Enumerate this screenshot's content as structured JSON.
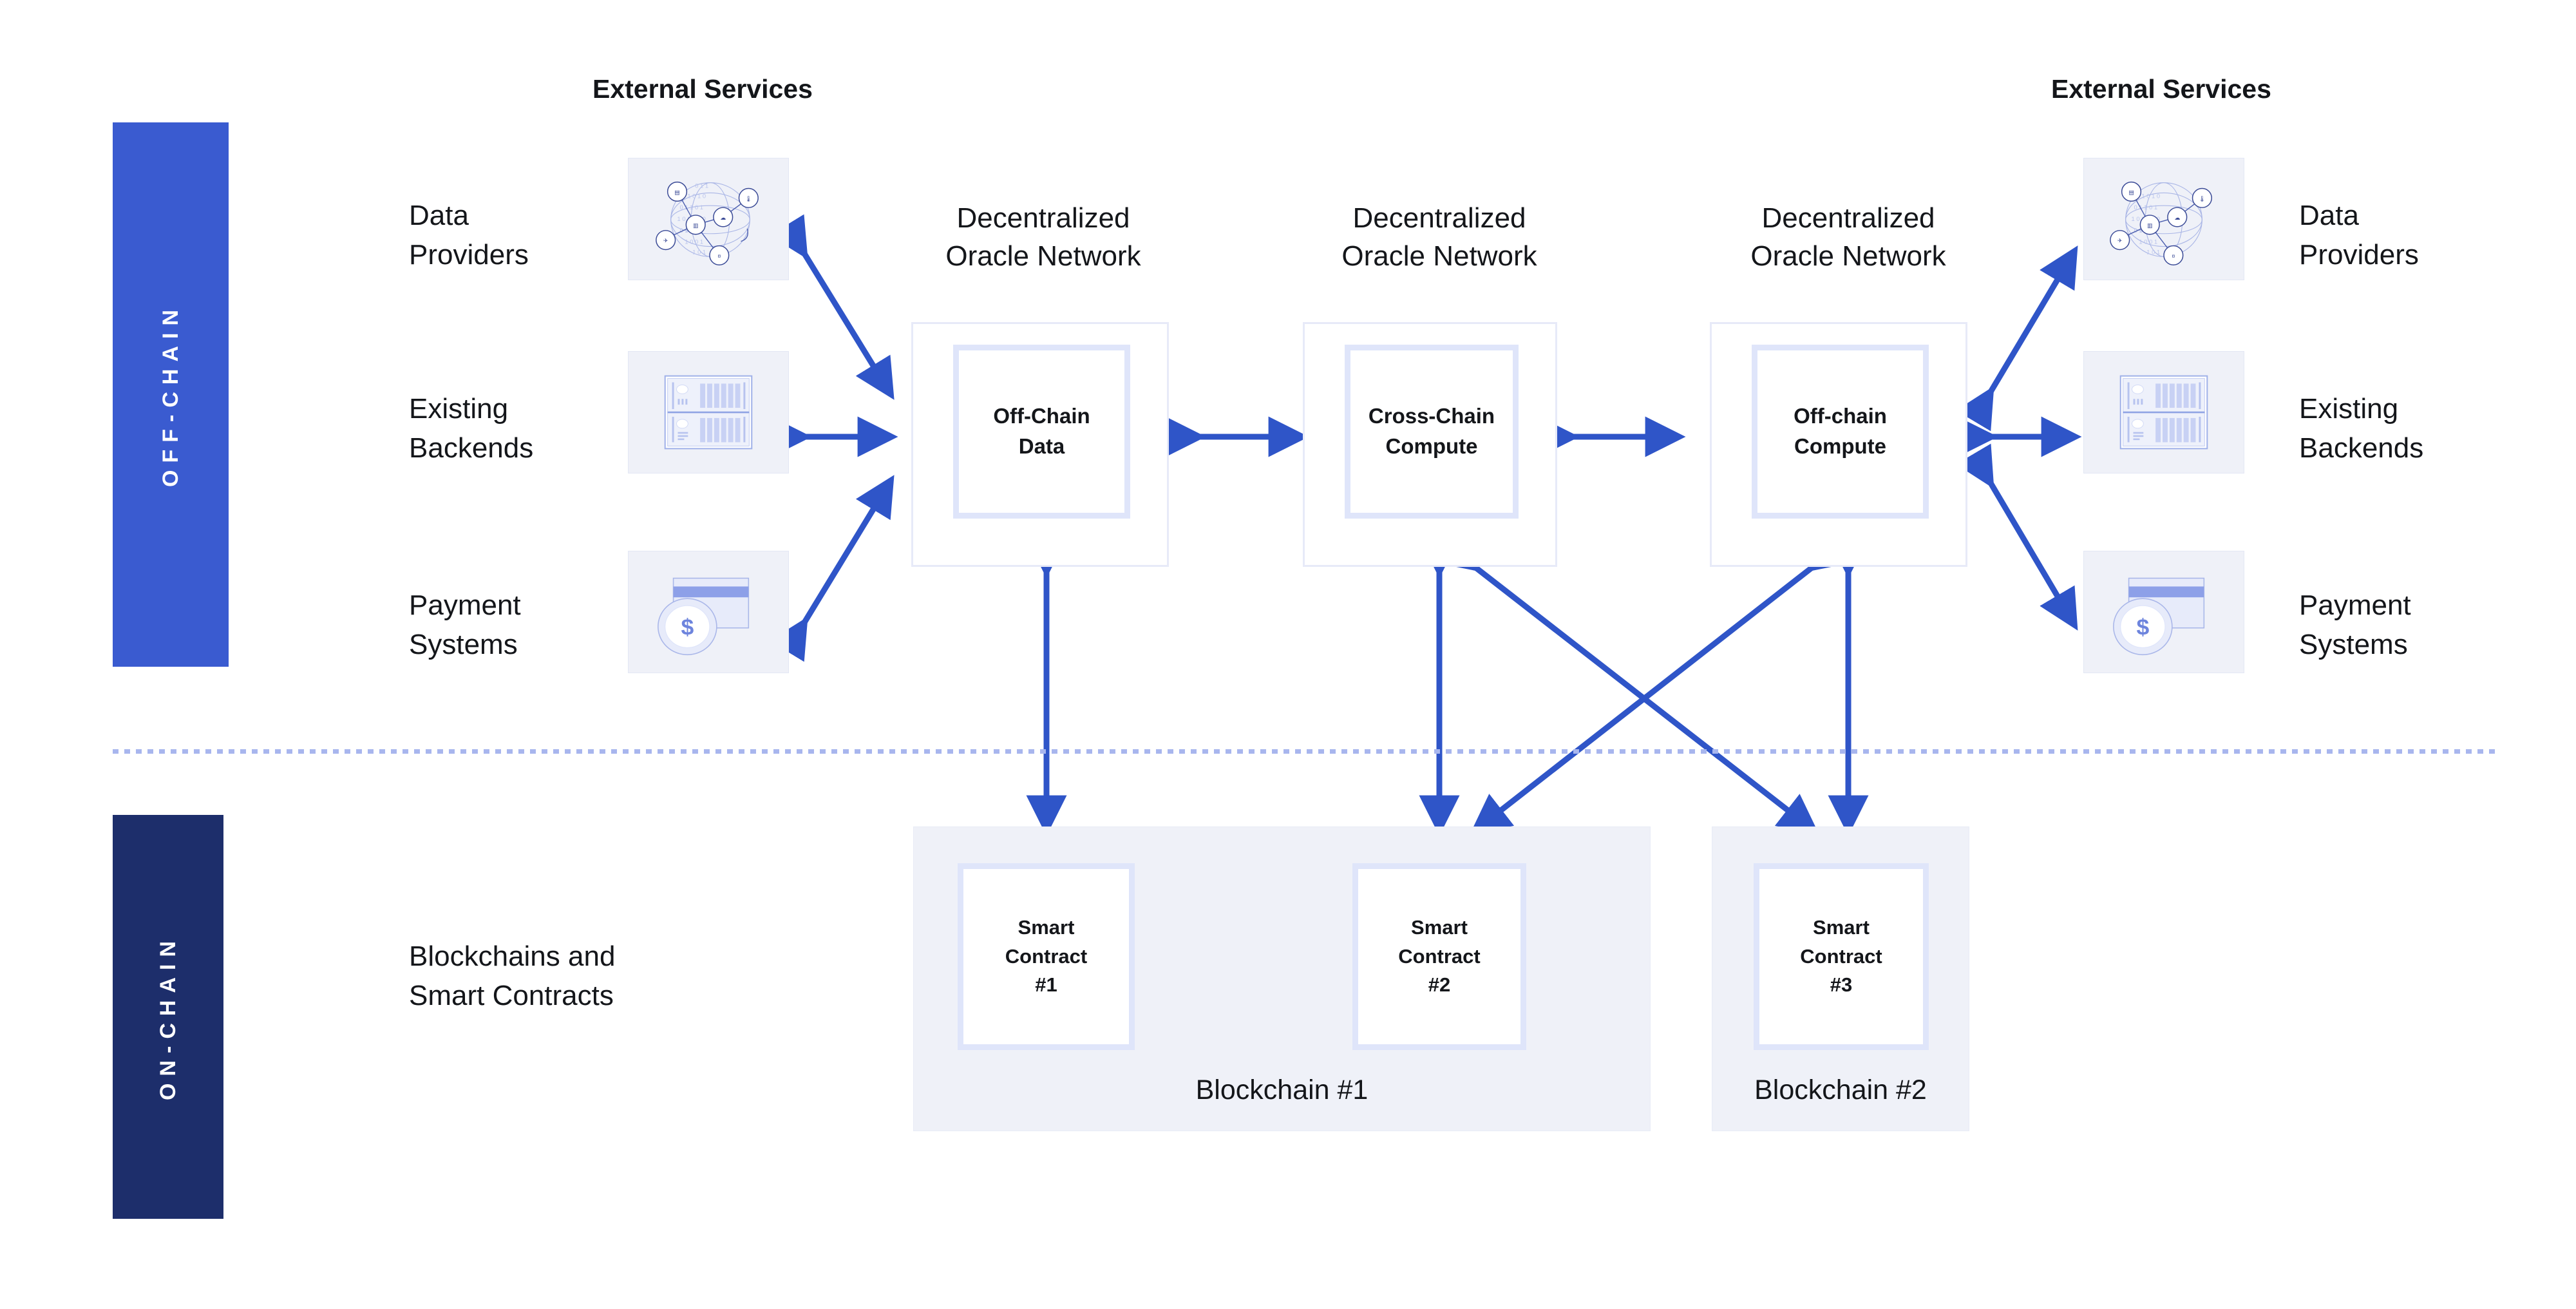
{
  "colors": {
    "arrow": "#2f55c8",
    "rail_offchain": "#3a5bd0",
    "rail_onchain": "#1d2e6b",
    "tile_fill": "#eff1f8",
    "inner_border": "#dfe5fa",
    "divider": "#a8b6ee",
    "text": "#14161a"
  },
  "rails": {
    "offchain": "OFF-CHAIN",
    "onchain": "ON-CHAIN"
  },
  "headings": {
    "external_services_left": "External Services",
    "external_services_right": "External Services"
  },
  "left_services": [
    {
      "label": "Data\nProviders",
      "icon": "data-globe-icon"
    },
    {
      "label": "Existing\nBackends",
      "icon": "server-rack-icon"
    },
    {
      "label": "Payment\nSystems",
      "icon": "credit-card-coin-icon"
    }
  ],
  "right_services": [
    {
      "label": "Data\nProviders",
      "icon": "data-globe-icon"
    },
    {
      "label": "Existing\nBackends",
      "icon": "server-rack-icon"
    },
    {
      "label": "Payment\nSystems",
      "icon": "credit-card-coin-icon"
    }
  ],
  "oracle_networks": [
    {
      "title": "Decentralized\nOracle Network",
      "inner": "Off-Chain\nData"
    },
    {
      "title": "Decentralized\nOracle Network",
      "inner": "Cross-Chain\nCompute"
    },
    {
      "title": "Decentralized\nOracle Network",
      "inner": "Off-chain\nCompute"
    }
  ],
  "onchain": {
    "section_label": "Blockchains and\nSmart Contracts",
    "chains": [
      {
        "name": "Blockchain #1",
        "contracts": [
          "Smart\nContract\n#1",
          "Smart\nContract\n#2"
        ]
      },
      {
        "name": "Blockchain #2",
        "contracts": [
          "Smart\nContract\n#3"
        ]
      }
    ]
  }
}
